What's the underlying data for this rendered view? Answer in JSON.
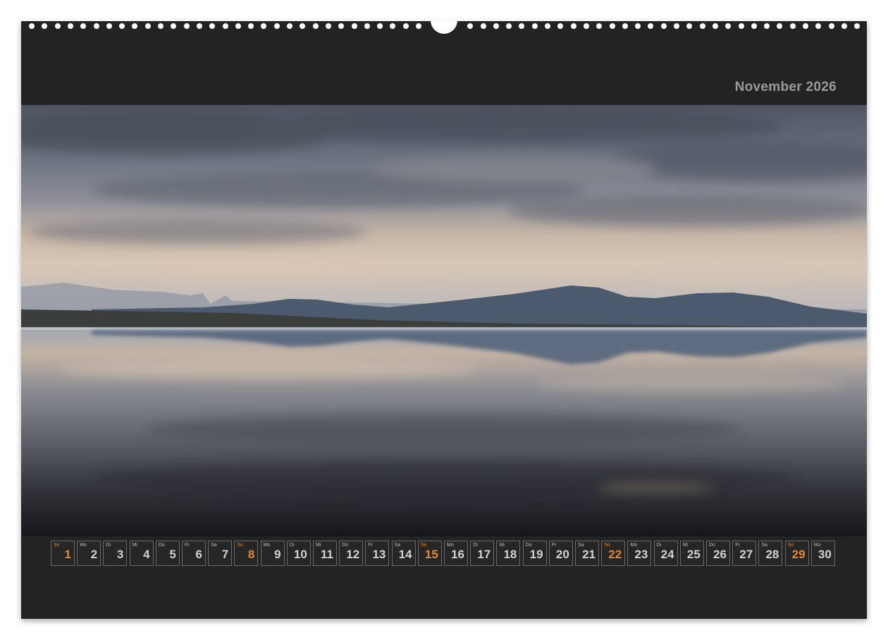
{
  "calendar": {
    "title": "November 2026",
    "accent_color": "#e58a2c",
    "background_color": "#232323",
    "photo_description_icon": "lake-mountain-reflection-photo",
    "days": [
      {
        "wd": "So",
        "num": "1",
        "sun": true
      },
      {
        "wd": "Mo",
        "num": "2"
      },
      {
        "wd": "Di",
        "num": "3"
      },
      {
        "wd": "Mi",
        "num": "4"
      },
      {
        "wd": "Do",
        "num": "5"
      },
      {
        "wd": "Fr",
        "num": "6"
      },
      {
        "wd": "Sa",
        "num": "7"
      },
      {
        "wd": "So",
        "num": "8",
        "sun": true
      },
      {
        "wd": "Mo",
        "num": "9"
      },
      {
        "wd": "Di",
        "num": "10"
      },
      {
        "wd": "Mi",
        "num": "11"
      },
      {
        "wd": "Do",
        "num": "12"
      },
      {
        "wd": "Fr",
        "num": "13"
      },
      {
        "wd": "Sa",
        "num": "14"
      },
      {
        "wd": "So",
        "num": "15",
        "sun": true
      },
      {
        "wd": "Mo",
        "num": "16"
      },
      {
        "wd": "Di",
        "num": "17"
      },
      {
        "wd": "Mi",
        "num": "18"
      },
      {
        "wd": "Do",
        "num": "19"
      },
      {
        "wd": "Fr",
        "num": "20"
      },
      {
        "wd": "Sa",
        "num": "21"
      },
      {
        "wd": "So",
        "num": "22",
        "sun": true
      },
      {
        "wd": "Mo",
        "num": "23"
      },
      {
        "wd": "Di",
        "num": "24"
      },
      {
        "wd": "Mi",
        "num": "25"
      },
      {
        "wd": "Do",
        "num": "26"
      },
      {
        "wd": "Fr",
        "num": "27"
      },
      {
        "wd": "Sa",
        "num": "28"
      },
      {
        "wd": "So",
        "num": "29",
        "sun": true
      },
      {
        "wd": "Mo",
        "num": "30"
      }
    ]
  }
}
